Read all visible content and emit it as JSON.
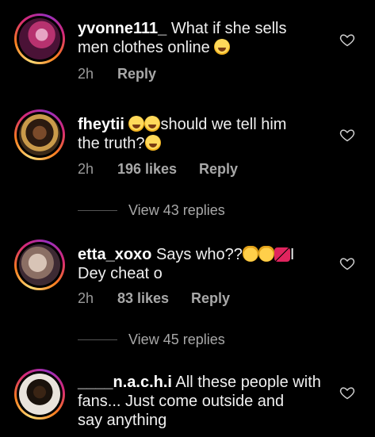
{
  "comments": [
    {
      "username": "yvonne111_",
      "text_line1": "What if she sells",
      "text_line2": "men clothes online",
      "time": "2h",
      "likes": "",
      "reply": "Reply"
    },
    {
      "username": "fheytii",
      "text_line1": "should we tell him",
      "text_line2": "the truth?",
      "time": "2h",
      "likes": "196 likes",
      "reply": "Reply",
      "view_replies": "View 43 replies"
    },
    {
      "username": "etta_xoxo",
      "text_line1": "Says who??",
      "text_line1_end": "I",
      "text_line2": "Dey cheat o",
      "time": "2h",
      "likes": "83 likes",
      "reply": "Reply",
      "view_replies": "View 45 replies"
    },
    {
      "username": "____n.a.c.h.i",
      "text_line1": "All these people with",
      "text_line2": "fans... Just come outside and",
      "text_line3": "say anything"
    }
  ],
  "icons": {
    "like": "heart-outline-icon",
    "emoji_laugh": "face-with-tears-of-joy-icon",
    "emoji_cat": "cat-with-tears-of-joy-icon",
    "emoji_heart": "broken-heart-icon"
  },
  "colors": {
    "background": "#000000",
    "text": "#f0f0f0",
    "secondary": "#9a9a9a"
  }
}
